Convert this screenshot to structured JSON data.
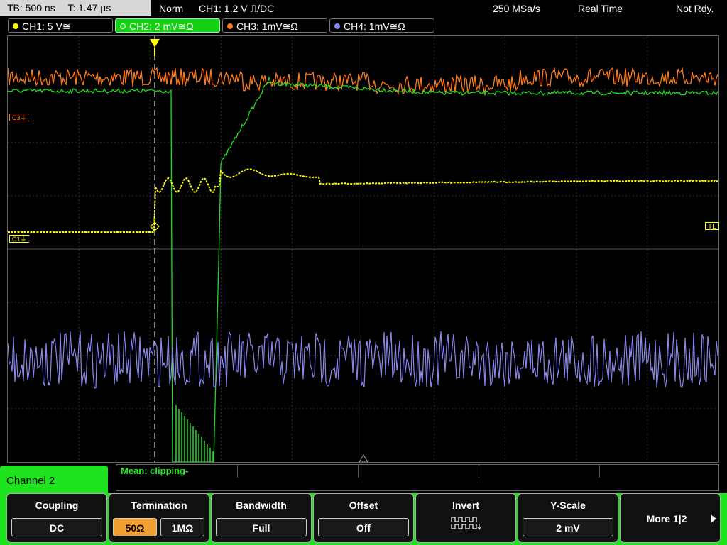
{
  "status": {
    "timebase": "TB: 500 ns",
    "trigger_time": "T: 1.47 µs",
    "mode": "Norm",
    "trigger_info": "CH1: 1.2 V ⎍/DC",
    "sample_rate": "250 MSa/s",
    "acq_mode": "Real Time",
    "ready_state": "Not Rdy."
  },
  "channels": [
    {
      "label": "CH1: 5 V≅",
      "color": "#ffff00"
    },
    {
      "label": "CH2: 2 mV≅Ω",
      "color": "#22dd22"
    },
    {
      "label": "CH3: 1mV≅Ω",
      "color": "#ff7a1a"
    },
    {
      "label": "CH4: 1mV≅Ω",
      "color": "#8888ff"
    }
  ],
  "markers": {
    "c3": "C3⏚",
    "c1": "C1⏚",
    "tl": "TL"
  },
  "channel_menu_title": "Channel 2",
  "measurement": "Mean: clipping-",
  "softkeys": {
    "coupling": {
      "label": "Coupling",
      "value": "DC"
    },
    "termination": {
      "label": "Termination",
      "value_a": "50Ω",
      "value_b": "1MΩ"
    },
    "bandwidth": {
      "label": "Bandwidth",
      "value": "Full"
    },
    "offset": {
      "label": "Offset",
      "value": "Off"
    },
    "invert": {
      "label": "Invert"
    },
    "yscale": {
      "label": "Y-Scale",
      "value": "2 mV"
    },
    "more": {
      "label": "More 1|2"
    }
  },
  "colors": {
    "ch1": "#ffff00",
    "ch2": "#22dd22",
    "ch3": "#ff7a1a",
    "ch4": "#8888ff",
    "menu_accent": "#1fe31f"
  }
}
